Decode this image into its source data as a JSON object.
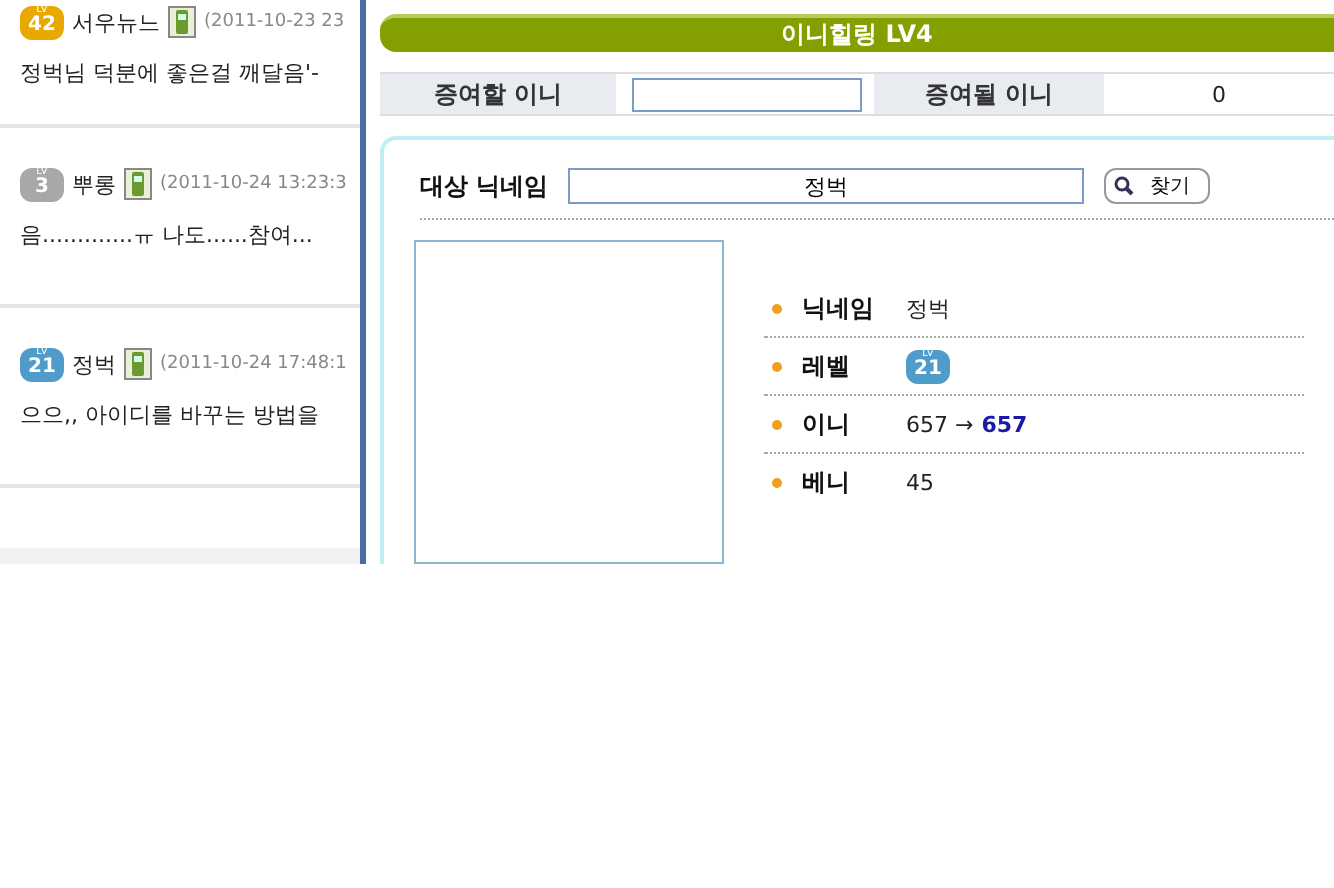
{
  "comments": [
    {
      "badge": "42",
      "badge_top": "LV",
      "color": "#e8a800",
      "name": "서우뉴느",
      "date": "(2011-10-23 23",
      "text": "정벅님 덕분에 좋은걸 깨달음'-"
    },
    {
      "badge": "3",
      "badge_top": "LV",
      "color": "#a8a8a8",
      "name": "뿌롱",
      "date": "(2011-10-24 13:23:3",
      "text": "음.............ㅠ 나도......참여..."
    },
    {
      "badge": "21",
      "badge_top": "LV",
      "color": "#4f9ccb",
      "name": "정벅",
      "date": "(2011-10-24 17:48:1",
      "text": "으으,, 아이디를 바꾸는 방법을"
    }
  ],
  "gift_panel": {
    "title": "이니힐링 LV4",
    "give_label": "증여할 이니",
    "receive_label": "증여될 이니",
    "receive_value": "0"
  },
  "search": {
    "label": "대상 닉네임",
    "value": "정벅",
    "button": "찾기"
  },
  "profile": {
    "rows": [
      {
        "kind": "text",
        "label": "닉네임",
        "value": "정벅"
      },
      {
        "kind": "level",
        "label": "레벨",
        "badge": "21",
        "badge_top": "LV",
        "color": "#4f9ccb"
      },
      {
        "kind": "transfer",
        "label": "이니",
        "from": "657",
        "arrow": "→",
        "to": "657"
      },
      {
        "kind": "text",
        "label": "베니",
        "value": "45"
      }
    ]
  }
}
